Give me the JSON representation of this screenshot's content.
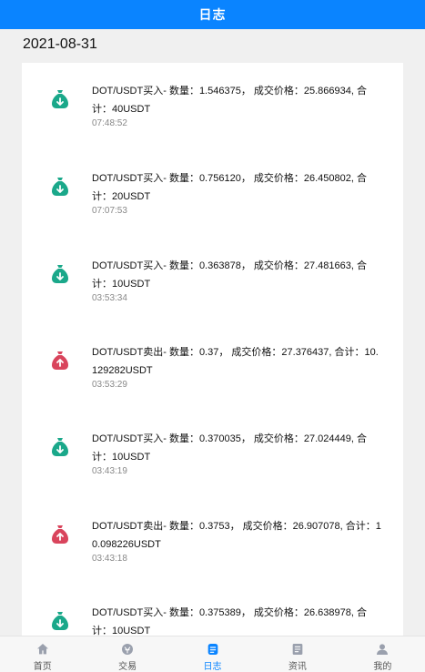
{
  "header": {
    "title": "日志"
  },
  "date": "2021-08-31",
  "colors": {
    "accent": "#0a84ff",
    "buy": "#1aa88a",
    "sell": "#d9445c"
  },
  "entries": [
    {
      "type": "buy",
      "icon": "money-bag-down-icon",
      "text": "DOT/USDT买入- 数量：1.546375， 成交价格：25.866934, 合计：40USDT",
      "time": "07:48:52"
    },
    {
      "type": "buy",
      "icon": "money-bag-down-icon",
      "text": "DOT/USDT买入- 数量：0.756120， 成交价格：26.450802, 合计：20USDT",
      "time": "07:07:53"
    },
    {
      "type": "buy",
      "icon": "money-bag-down-icon",
      "text": "DOT/USDT买入- 数量：0.363878， 成交价格：27.481663, 合计：10USDT",
      "time": "03:53:34"
    },
    {
      "type": "sell",
      "icon": "money-bag-up-icon",
      "text": "DOT/USDT卖出- 数量：0.37， 成交价格：27.376437, 合计：10.129282USDT",
      "time": "03:53:29"
    },
    {
      "type": "buy",
      "icon": "money-bag-down-icon",
      "text": "DOT/USDT买入- 数量：0.370035， 成交价格：27.024449, 合计：10USDT",
      "time": "03:43:19"
    },
    {
      "type": "sell",
      "icon": "money-bag-up-icon",
      "text": "DOT/USDT卖出- 数量：0.3753， 成交价格：26.907078, 合计：10.098226USDT",
      "time": "03:43:18"
    },
    {
      "type": "buy",
      "icon": "money-bag-down-icon",
      "text": "DOT/USDT买入- 数量：0.375389， 成交价格：26.638978, 合计：10USDT",
      "time": ""
    }
  ],
  "tabbar": {
    "items": [
      {
        "label": "首页",
        "icon": "home-icon",
        "active": false
      },
      {
        "label": "交易",
        "icon": "exchange-icon",
        "active": false
      },
      {
        "label": "日志",
        "icon": "log-icon",
        "active": true
      },
      {
        "label": "资讯",
        "icon": "news-icon",
        "active": false
      },
      {
        "label": "我的",
        "icon": "profile-icon",
        "active": false
      }
    ]
  }
}
